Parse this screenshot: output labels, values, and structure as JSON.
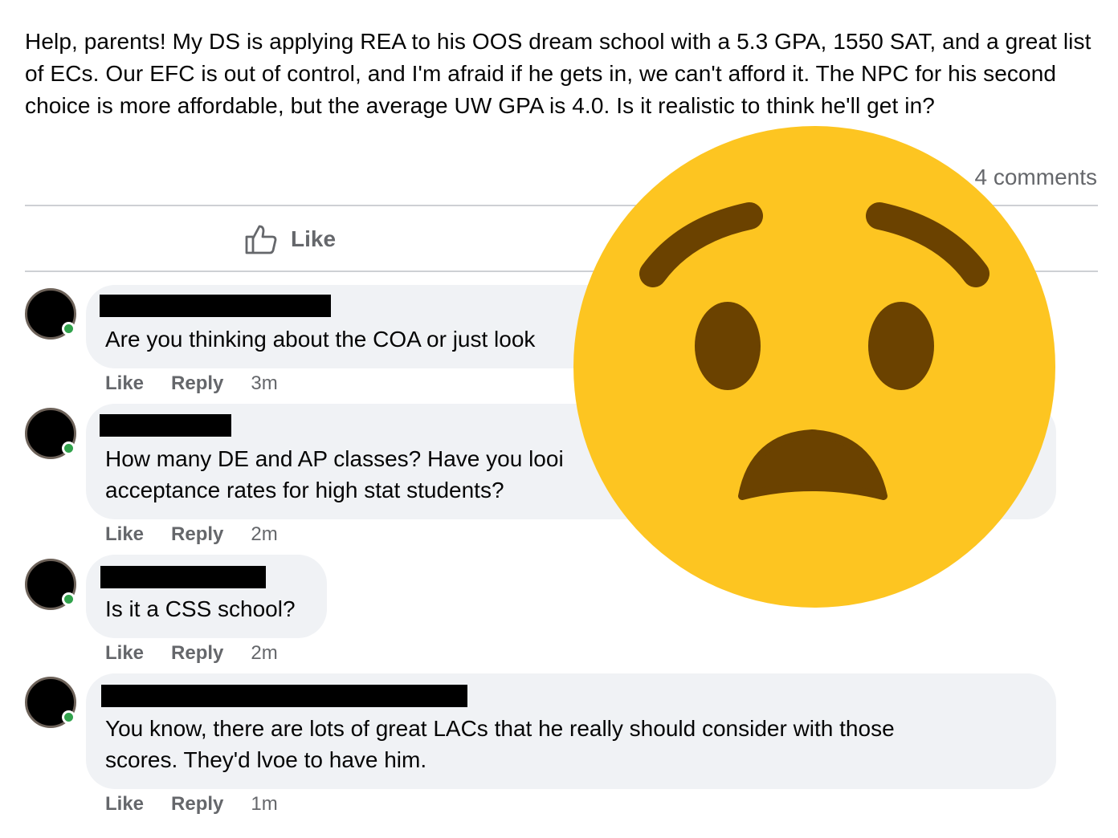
{
  "post": {
    "text": "Help, parents! My DS is applying REA to his OOS dream school with a 5.3 GPA, 1550 SAT, and a great list of ECs. Our EFC is out of control, and I'm afraid if he gets in, we can't afford it. The NPC for his second choice is more affordable, but the average UW GPA is 4.0. Is it realistic to think he'll get in?",
    "comment_count": "4 comments",
    "like_label": "Like"
  },
  "comments": [
    {
      "text": "Are you thinking about the COA or just look",
      "like_label": "Like",
      "reply_label": "Reply",
      "time": "3m"
    },
    {
      "text_line1": "How many DE and AP classes? Have you looi",
      "text_line2": "acceptance rates for high stat students?",
      "like_label": "Like",
      "reply_label": "Reply",
      "time": "2m"
    },
    {
      "text": "Is it a CSS school?",
      "like_label": "Like",
      "reply_label": "Reply",
      "time": "2m"
    },
    {
      "text_line1": "You know, there are lots of great LACs that he really should consider with those",
      "text_line2": "scores. They'd lvoe to have him.",
      "like_label": "Like",
      "reply_label": "Reply",
      "time": "1m"
    }
  ],
  "overlay": {
    "icon": "anxious-face-emoji",
    "color": "#fdc521",
    "feature_color": "#6b4200"
  },
  "colors": {
    "online": "#31a24c",
    "bubble": "#f0f2f5",
    "muted": "#65676b"
  }
}
